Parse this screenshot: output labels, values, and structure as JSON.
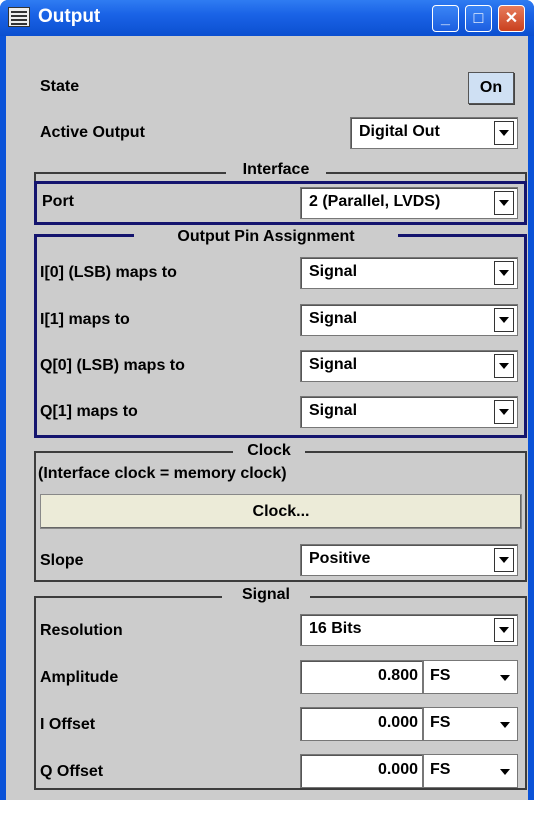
{
  "window": {
    "title": "Output",
    "minimize": "_",
    "maximize": "□",
    "close": "✕"
  },
  "state": {
    "label": "State",
    "button": "On"
  },
  "active_output": {
    "label": "Active Output",
    "value": "Digital Out"
  },
  "interface": {
    "legend": "Interface",
    "port": {
      "label": "Port",
      "value": "2 (Parallel, LVDS)"
    }
  },
  "pin_assignment": {
    "legend": "Output Pin Assignment",
    "rows": [
      {
        "label": "I[0] (LSB) maps to",
        "value": "Signal"
      },
      {
        "label": "I[1] maps to",
        "value": "Signal"
      },
      {
        "label": "Q[0] (LSB) maps to",
        "value": "Signal"
      },
      {
        "label": "Q[1] maps to",
        "value": "Signal"
      }
    ]
  },
  "clock": {
    "legend": "Clock",
    "note": "(Interface clock = memory clock)",
    "button": "Clock...",
    "slope": {
      "label": "Slope",
      "value": "Positive"
    }
  },
  "signal": {
    "legend": "Signal",
    "resolution": {
      "label": "Resolution",
      "value": "16 Bits"
    },
    "amplitude": {
      "label": "Amplitude",
      "value": "0.800",
      "unit": "FS"
    },
    "i_offset": {
      "label": "I Offset",
      "value": "0.000",
      "unit": "FS"
    },
    "q_offset": {
      "label": "Q Offset",
      "value": "0.000",
      "unit": "FS"
    }
  }
}
